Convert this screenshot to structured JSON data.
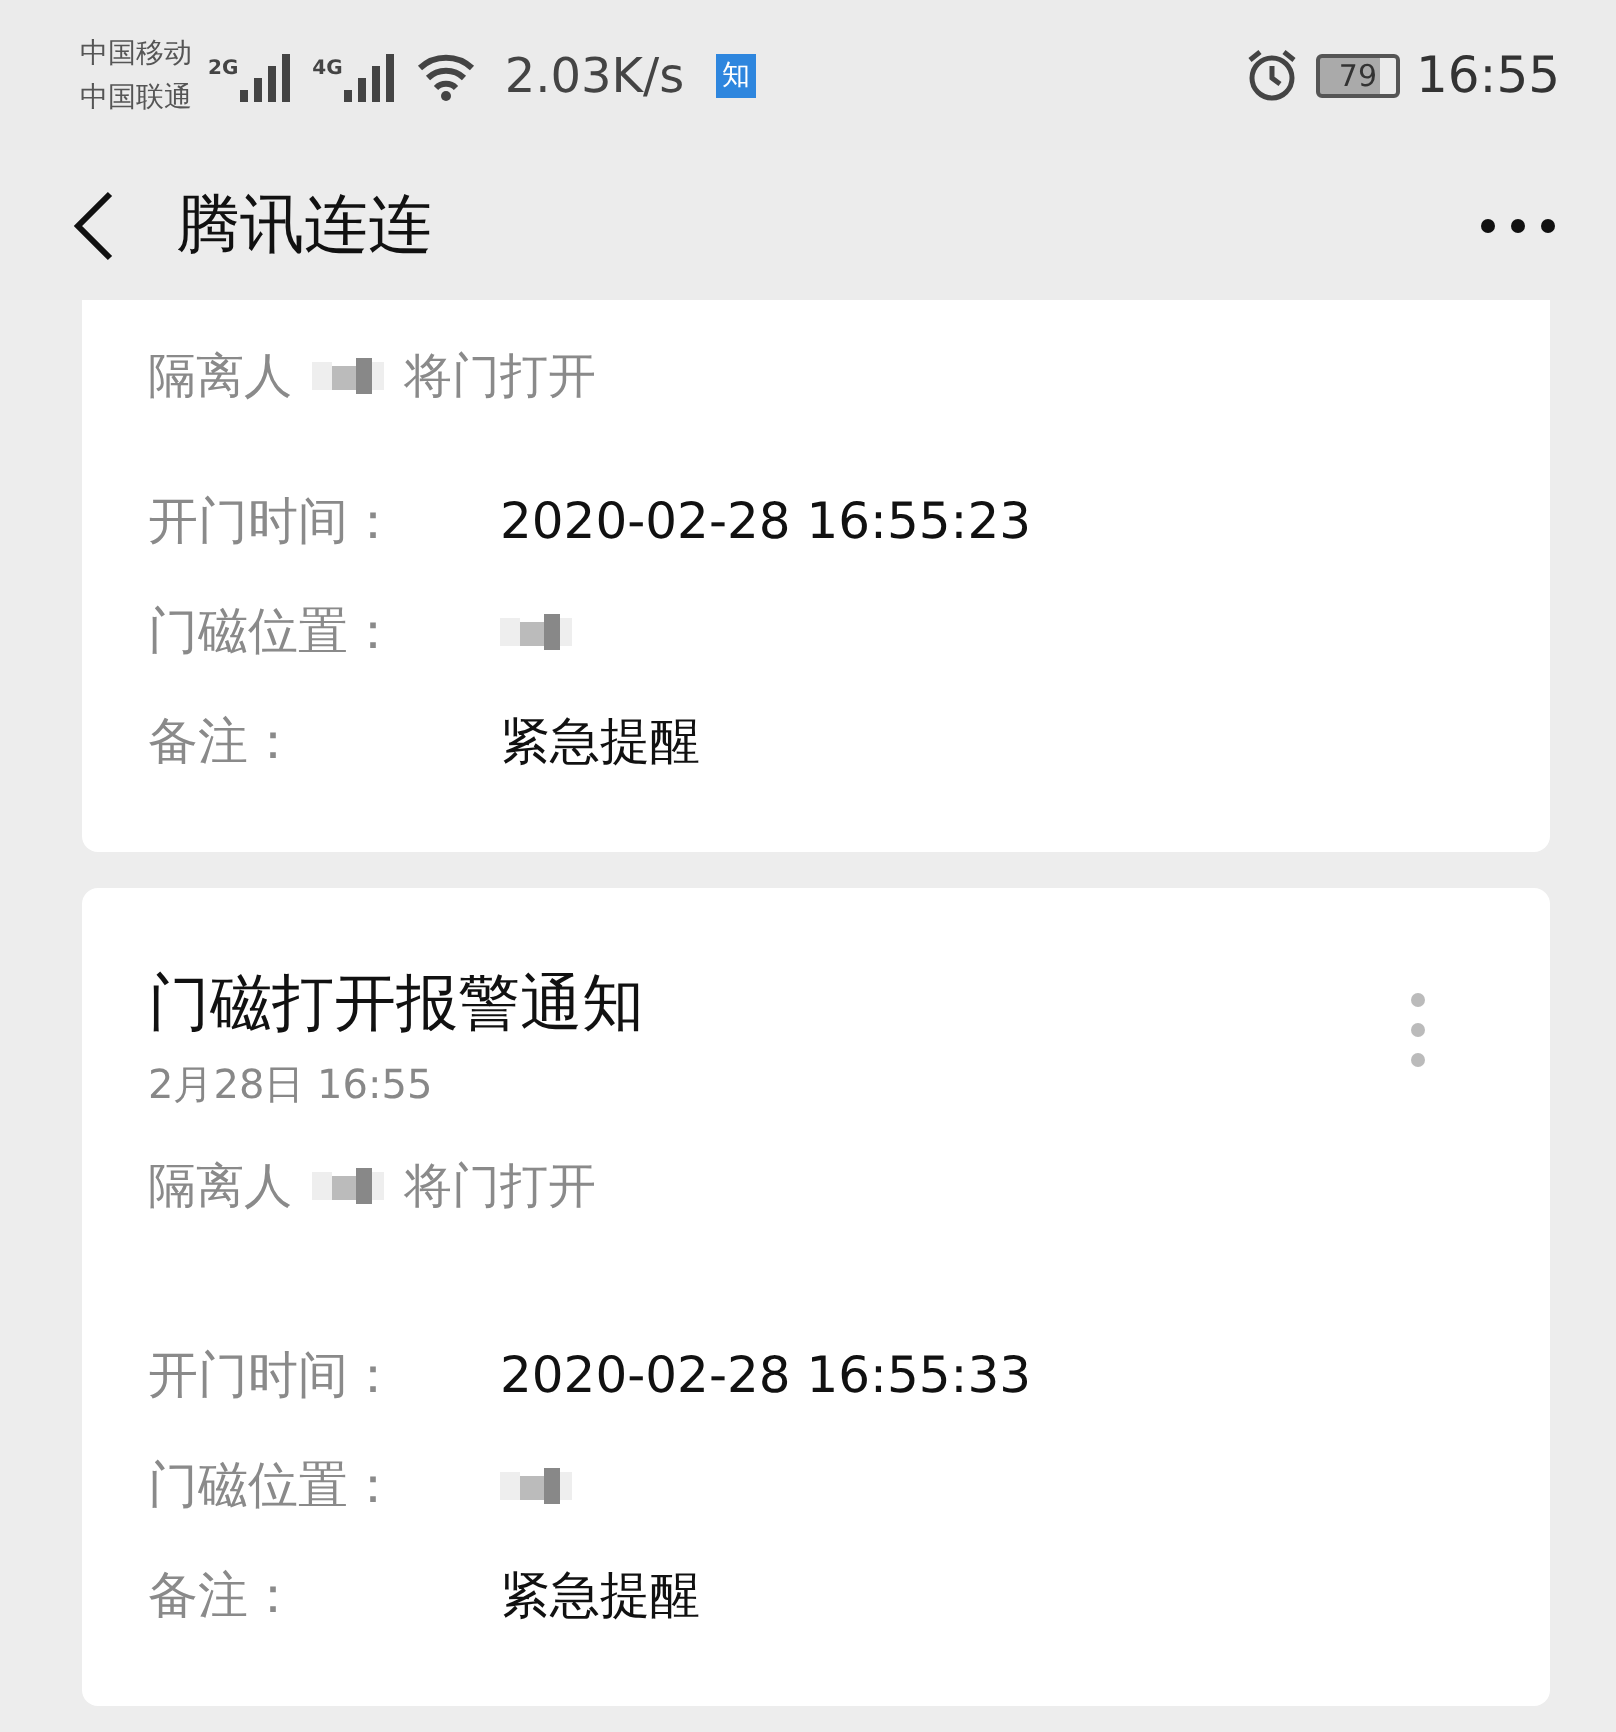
{
  "status_bar": {
    "carriers": [
      "中国移动",
      "中国联通"
    ],
    "signals": [
      {
        "label": "2G"
      },
      {
        "label": "4G"
      }
    ],
    "speed": "2.03K/s",
    "badge": "知",
    "battery": "79",
    "time": "16:55"
  },
  "header": {
    "title": "腾讯连连"
  },
  "cards": [
    {
      "description": [
        {
          "kind": "text",
          "text": "隔离人"
        },
        {
          "kind": "redacted"
        },
        {
          "kind": "text",
          "text": "将门打开"
        }
      ],
      "fields": [
        {
          "label": "开门时间：",
          "kind": "text",
          "value": "2020-02-28 16:55:23"
        },
        {
          "label": "门磁位置：",
          "kind": "redacted"
        },
        {
          "label": "备注：",
          "kind": "text",
          "value": "紧急提醒"
        }
      ]
    },
    {
      "title": "门磁打开报警通知",
      "date": "2月28日  16:55",
      "description": [
        {
          "kind": "text",
          "text": "隔离人"
        },
        {
          "kind": "redacted"
        },
        {
          "kind": "text",
          "text": "将门打开"
        }
      ],
      "fields": [
        {
          "label": "开门时间：",
          "kind": "text",
          "value": "2020-02-28 16:55:33"
        },
        {
          "label": "门磁位置：",
          "kind": "redacted"
        },
        {
          "label": "备注：",
          "kind": "text",
          "value": "紧急提醒"
        }
      ]
    }
  ]
}
